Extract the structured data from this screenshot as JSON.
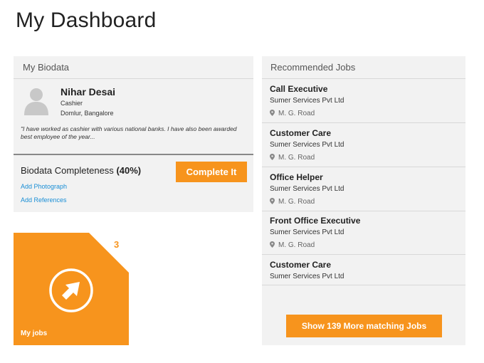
{
  "page": {
    "title": "My Dashboard"
  },
  "biodata": {
    "header": "My Biodata",
    "name": "Nihar Desai",
    "role": "Cashier",
    "location": "Domlur, Bangalore",
    "quote": "\"I have worked as cashier with various national banks. I have also been awarded best employee of the year...",
    "completeness_label": "Biodata Completeness",
    "completeness_value": "(40%)",
    "complete_button": "Complete It",
    "links": [
      "Add Photograph",
      "Add References"
    ]
  },
  "tile": {
    "label": "My jobs",
    "count": "3",
    "icon": "arrow-circle-icon"
  },
  "jobs": {
    "header": "Recommended Jobs",
    "items": [
      {
        "title": "Call Executive",
        "company": "Sumer Services Pvt Ltd",
        "location": "M. G. Road"
      },
      {
        "title": "Customer Care",
        "company": "Sumer Services Pvt Ltd",
        "location": "M. G. Road"
      },
      {
        "title": "Office Helper",
        "company": "Sumer Services Pvt Ltd",
        "location": "M. G. Road"
      },
      {
        "title": "Front Office Executive",
        "company": "Sumer Services Pvt Ltd",
        "location": "M. G. Road"
      },
      {
        "title": "Customer Care",
        "company": "Sumer Services Pvt Ltd",
        "location": ""
      }
    ],
    "more_button": "Show 139 More matching Jobs"
  },
  "colors": {
    "accent": "#f7941d",
    "link": "#1a8fd6",
    "card_bg": "#f2f2f2"
  }
}
